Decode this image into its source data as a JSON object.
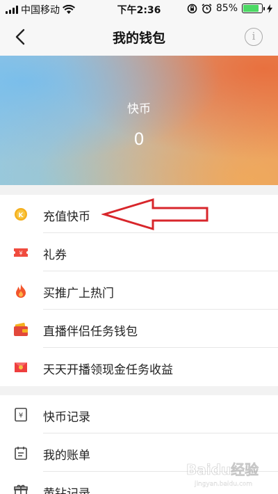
{
  "status_bar": {
    "carrier": "中国移动",
    "time": "下午2:36",
    "battery": "85%"
  },
  "nav": {
    "title": "我的钱包",
    "info_icon": "i"
  },
  "wallet": {
    "label": "快币",
    "balance": "0"
  },
  "menu_primary": [
    {
      "label": "充值快币",
      "icon": "coin-icon"
    },
    {
      "label": "礼券",
      "icon": "coupon-icon"
    },
    {
      "label": "买推广上热门",
      "icon": "fire-icon"
    },
    {
      "label": "直播伴侣任务钱包",
      "icon": "wallet-icon"
    },
    {
      "label": "天天开播领现金任务收益",
      "icon": "red-envelope-icon"
    }
  ],
  "menu_secondary": [
    {
      "label": "快币记录",
      "icon": "yen-record-icon"
    },
    {
      "label": "我的账单",
      "icon": "calendar-bill-icon"
    },
    {
      "label": "黄钻记录",
      "icon": "gift-icon"
    }
  ],
  "watermark": {
    "text": "Baidu经验",
    "url": "jingyan.baidu.com"
  }
}
